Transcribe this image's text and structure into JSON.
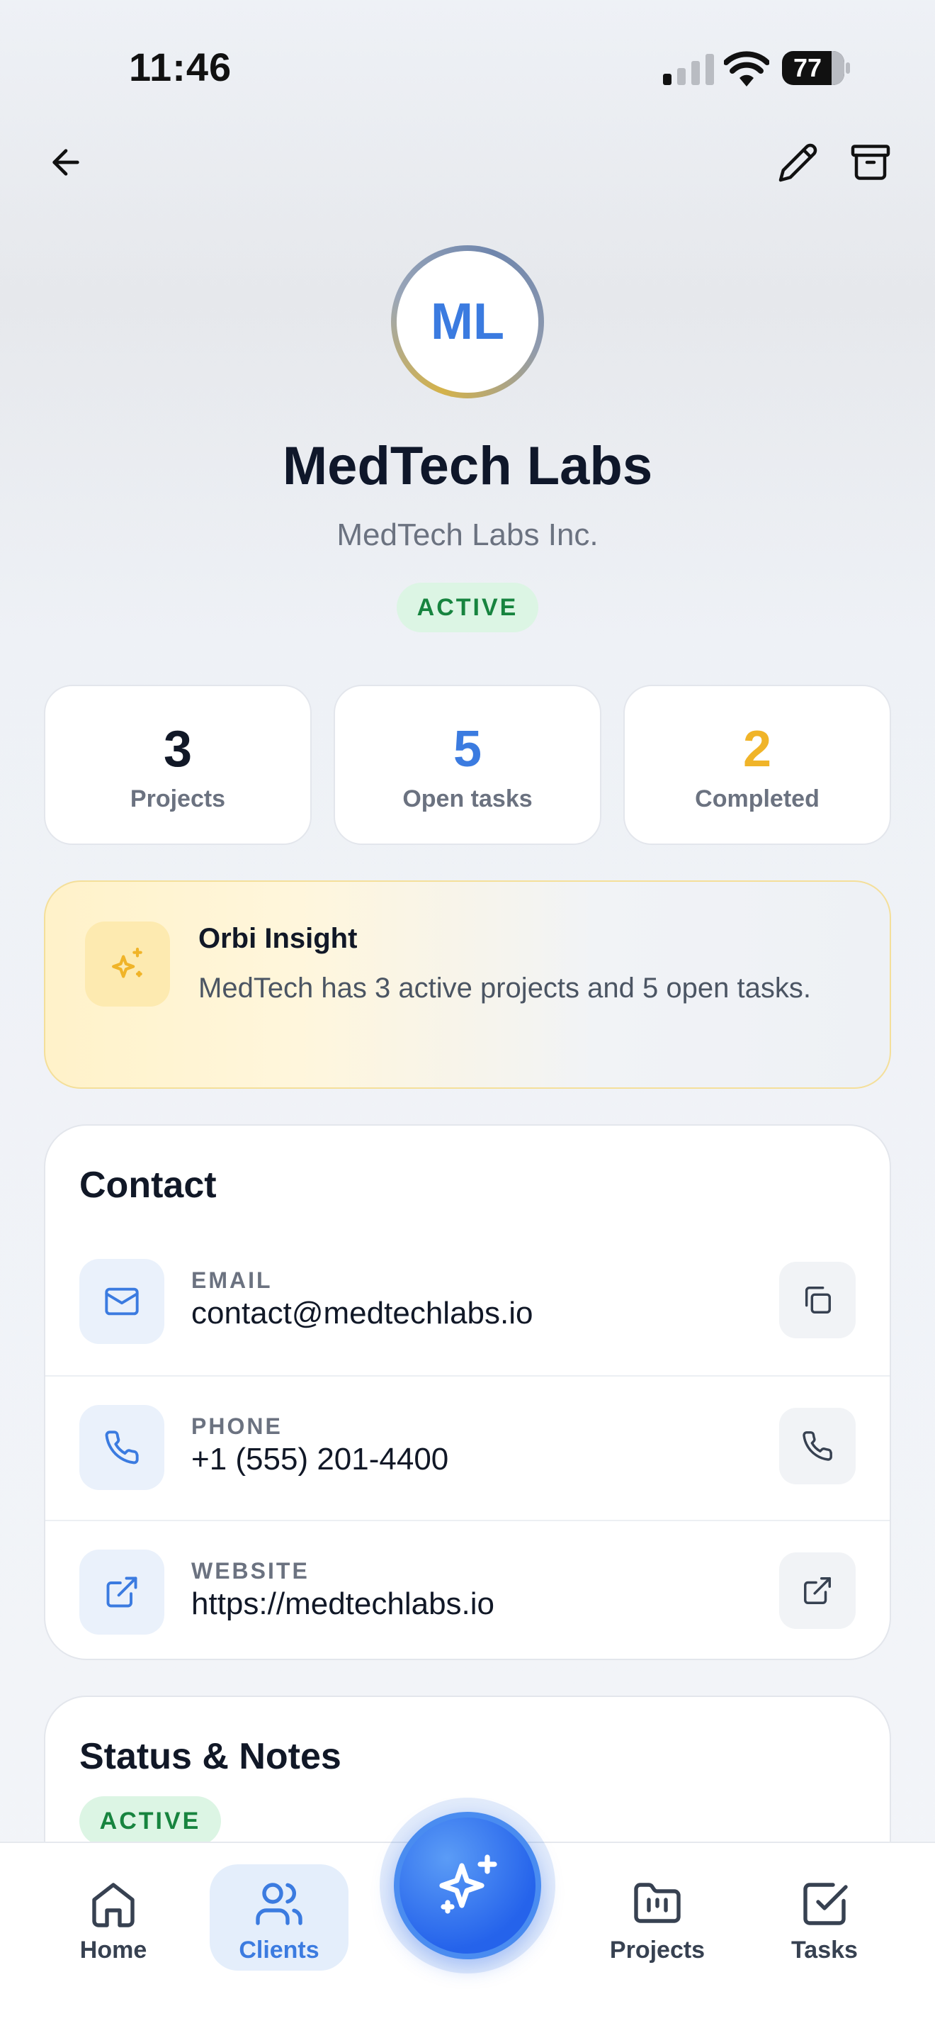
{
  "status_bar": {
    "time": "11:46",
    "battery": "77"
  },
  "header": {
    "avatar_initials": "ML",
    "name": "MedTech Labs",
    "legal_name": "MedTech Labs Inc.",
    "status": "ACTIVE"
  },
  "stats": [
    {
      "value": "3",
      "label": "Projects",
      "color": "#111827"
    },
    {
      "value": "5",
      "label": "Open tasks",
      "color": "#3b7be0"
    },
    {
      "value": "2",
      "label": "Completed",
      "color": "#f0b429"
    }
  ],
  "insight": {
    "title": "Orbi Insight",
    "text": "MedTech has 3 active projects and 5 open tasks.",
    "icon": "sparkles-icon"
  },
  "contact": {
    "title": "Contact",
    "rows": [
      {
        "label": "EMAIL",
        "value": "contact@medtechlabs.io",
        "icon": "mail-icon",
        "action_icon": "copy-icon"
      },
      {
        "label": "PHONE",
        "value": "+1 (555) 201-4400",
        "icon": "phone-icon",
        "action_icon": "phone-icon"
      },
      {
        "label": "WEBSITE",
        "value": "https://medtechlabs.io",
        "icon": "external-link-icon",
        "action_icon": "external-link-icon"
      }
    ]
  },
  "notes": {
    "title": "Status & Notes",
    "status": "ACTIVE"
  },
  "tabbar": {
    "tabs": [
      {
        "label": "Home",
        "icon": "home-icon"
      },
      {
        "label": "Clients",
        "icon": "users-icon",
        "active": true
      },
      {
        "label": "Projects",
        "icon": "folder-icon"
      },
      {
        "label": "Tasks",
        "icon": "checkbox-icon"
      }
    ],
    "fab_icon": "sparkles-icon"
  },
  "colors": {
    "accent": "#3b7be0",
    "success": "#17843f",
    "success_bg": "#dcf5e4",
    "warning": "#f0b429"
  }
}
